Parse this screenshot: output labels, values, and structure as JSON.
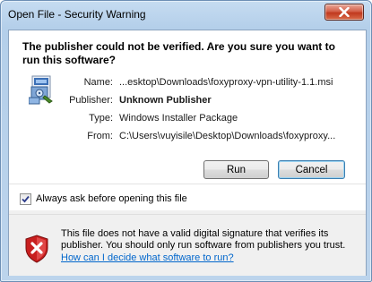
{
  "window": {
    "title": "Open File - Security Warning"
  },
  "headline": "The publisher could not be verified.  Are you sure you want to run this software?",
  "fields": [
    {
      "label": "Name:",
      "value": "...esktop\\Downloads\\foxyproxy-vpn-utility-1.1.msi"
    },
    {
      "label": "Publisher:",
      "value": "Unknown Publisher"
    },
    {
      "label": "Type:",
      "value": "Windows Installer Package"
    },
    {
      "label": "From:",
      "value": "C:\\Users\\vuyisile\\Desktop\\Downloads\\foxyproxy..."
    }
  ],
  "buttons": {
    "run": "Run",
    "cancel": "Cancel"
  },
  "checkbox": {
    "label": "Always ask before opening this file",
    "checked": true
  },
  "warning": {
    "text": "This file does not have a valid digital signature that verifies its publisher.  You should only run software from publishers you trust.",
    "link": "How can I decide what software to run?"
  },
  "icons": {
    "app": "installer-package-icon",
    "warning": "red-shield-x-icon",
    "close": "close-icon",
    "check": "checkmark-icon"
  }
}
